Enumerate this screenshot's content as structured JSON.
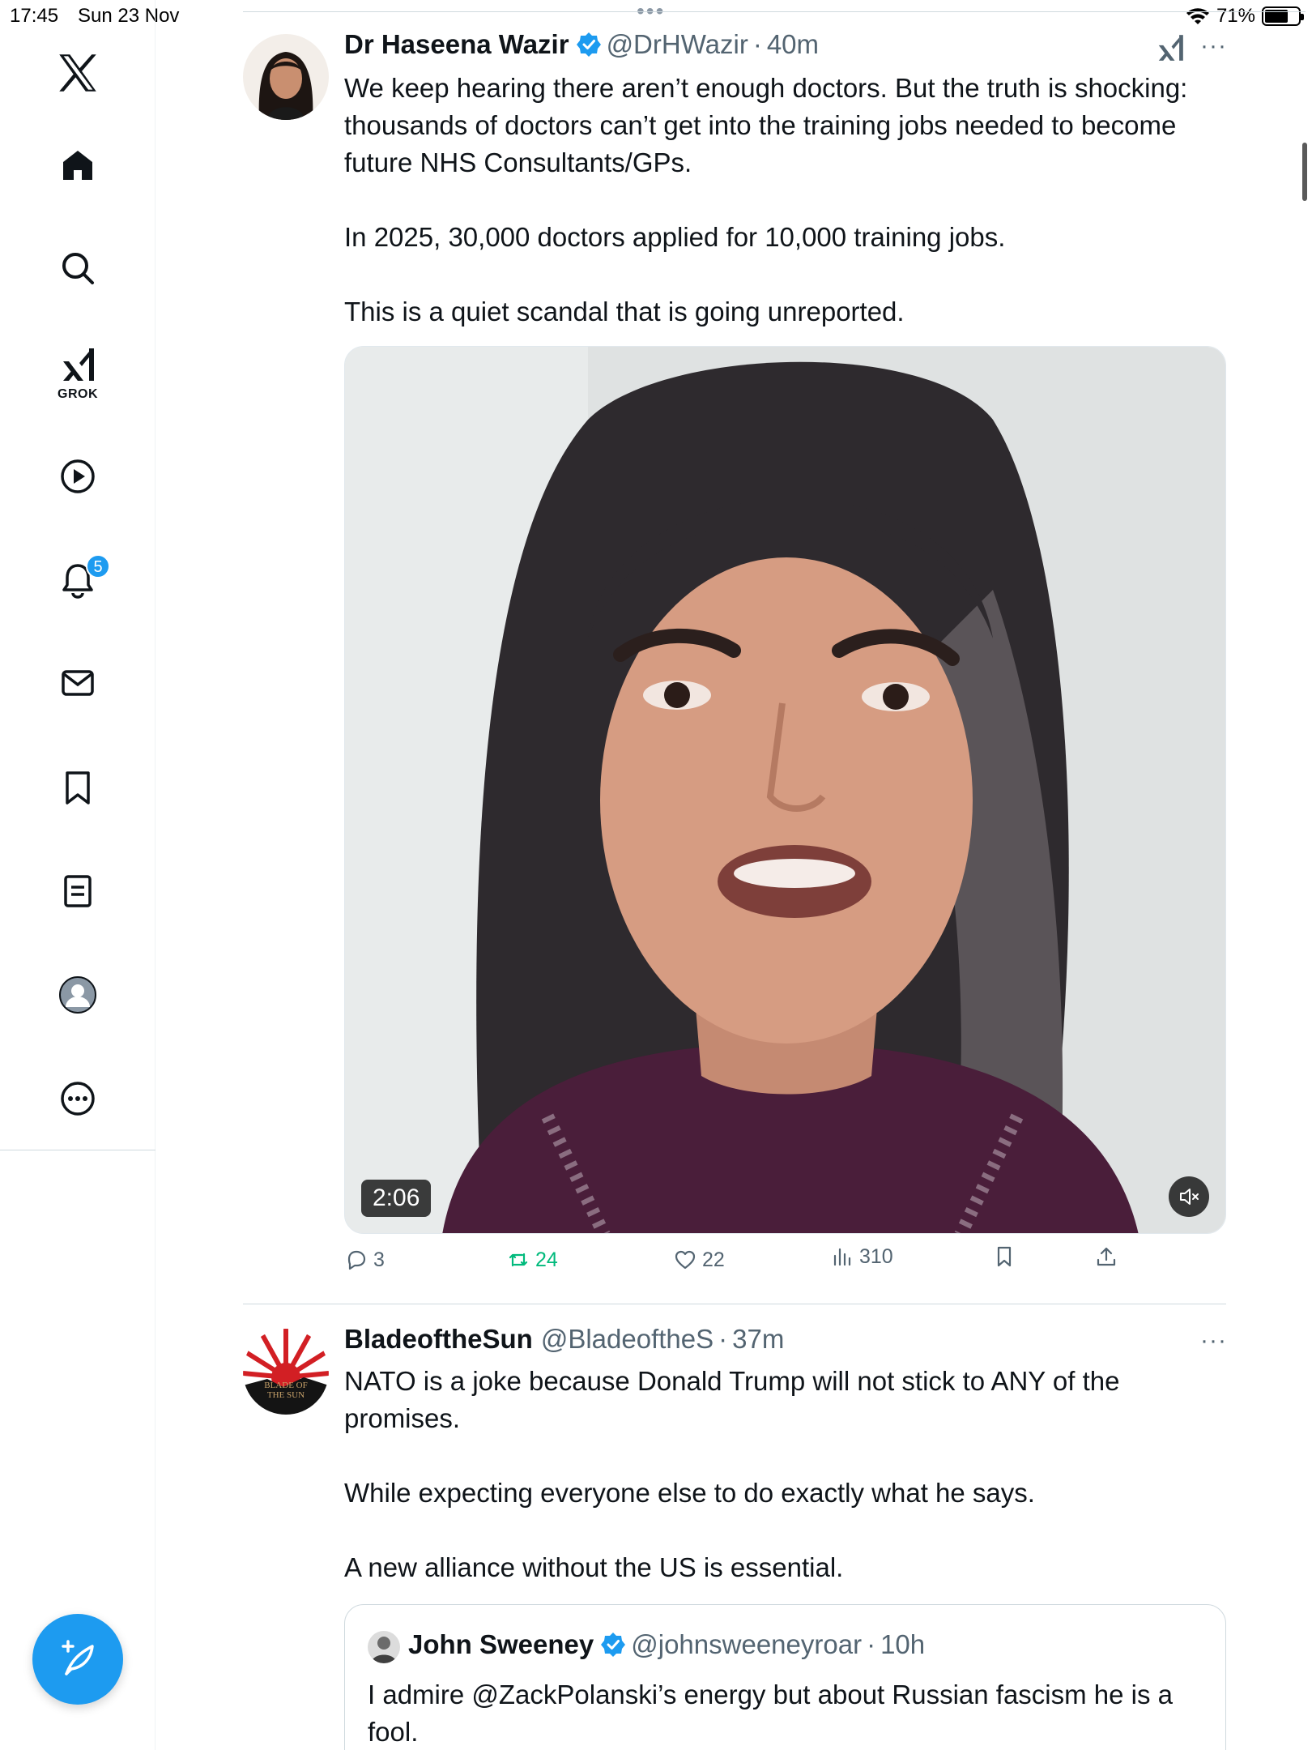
{
  "status_bar": {
    "time": "17:45",
    "date": "Sun 23 Nov",
    "battery": "71%",
    "battery_level": 0.71
  },
  "sidebar": {
    "items": [
      {
        "name": "home",
        "icon": "home-icon"
      },
      {
        "name": "explore",
        "icon": "search-icon"
      },
      {
        "name": "grok",
        "icon": "grok-icon",
        "label": "GROK"
      },
      {
        "name": "videos",
        "icon": "play-icon"
      },
      {
        "name": "notifications",
        "icon": "bell-icon",
        "badge": "5"
      },
      {
        "name": "messages",
        "icon": "mail-icon"
      },
      {
        "name": "bookmarks",
        "icon": "bookmark-icon"
      },
      {
        "name": "lists",
        "icon": "list-icon"
      },
      {
        "name": "profile",
        "icon": "avatar-icon"
      },
      {
        "name": "more",
        "icon": "more-icon"
      }
    ],
    "compose_icon": "compose-icon"
  },
  "posts": [
    {
      "name": "Dr Haseena Wazir",
      "handle": "@DrHWazir",
      "separator": "·",
      "time": "40m",
      "verified": true,
      "text": [
        "We keep hearing there aren’t enough doctors. But the truth is shocking: thousands of doctors can’t get into the training jobs needed to become future NHS Consultants/GPs.",
        "In 2025, 30,000 doctors applied for 10,000 training jobs.",
        "This is a quiet scandal that is going unreported."
      ],
      "media": {
        "type": "video",
        "duration": "2:06",
        "muted": true
      },
      "actions": {
        "replies": "3",
        "reposts": "24",
        "likes": "22",
        "views": "310"
      }
    },
    {
      "name": "BladeoftheSun",
      "handle": "@BladeoftheS",
      "separator": "·",
      "time": "37m",
      "verified": false,
      "avatar_text": "BLADE OF THE SUN",
      "text": [
        "NATO is a joke because Donald Trump will not stick to ANY of the promises.",
        "While expecting everyone else to do exactly what he says.",
        "A new alliance without the US is essential."
      ],
      "quote": {
        "name": "John Sweeney",
        "handle": "@johnsweeneyroar",
        "separator": "·",
        "time": "10h",
        "verified": true,
        "text": "I admire @ZackPolanski’s energy but about Russian fascism he is a fool."
      }
    }
  ],
  "colors": {
    "accent": "#1d9bf0",
    "text": "#0f1419",
    "muted": "#536471",
    "repost": "#00ba7c",
    "border": "#cfd9de"
  }
}
